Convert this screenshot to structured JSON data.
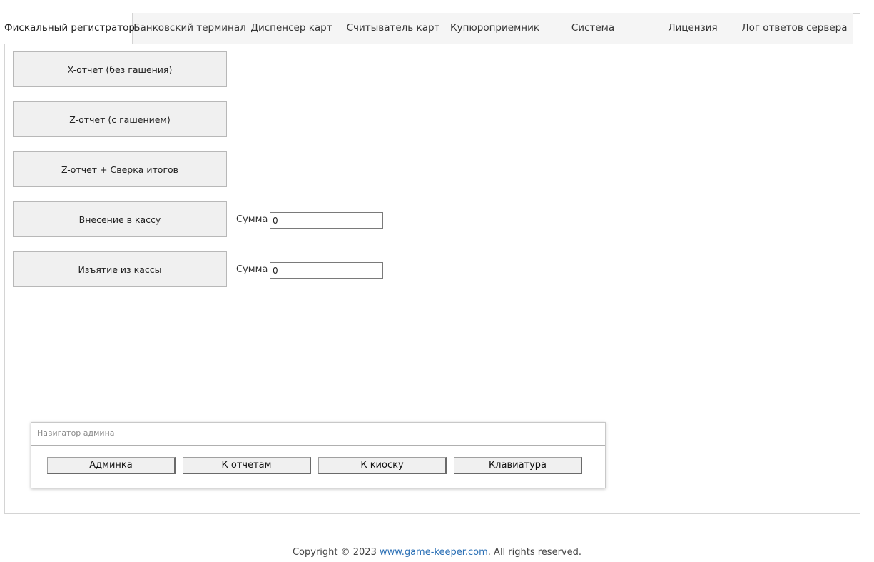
{
  "tabs": [
    {
      "label": "Фискальный регистратор",
      "active": true
    },
    {
      "label": "Банковский терминал",
      "active": false
    },
    {
      "label": "Диспенсер карт",
      "active": false
    },
    {
      "label": "Считыватель карт",
      "active": false
    },
    {
      "label": "Купюроприемник",
      "active": false
    },
    {
      "label": "Система",
      "active": false
    },
    {
      "label": "Лицензия",
      "active": false
    },
    {
      "label": "Лог ответов сервера",
      "active": false
    }
  ],
  "fiscal": {
    "x_report_label": "X-отчет (без гашения)",
    "z_report_label": "Z-отчет (с гашением)",
    "z_reconcile_label": "Z-отчет + Сверка итогов",
    "deposit_label": "Внесение в кассу",
    "deposit_sum_label": "Сумма",
    "deposit_sum_value": "0",
    "withdraw_label": "Изъятие из кассы",
    "withdraw_sum_label": "Сумма",
    "withdraw_sum_value": "0"
  },
  "admin_nav": {
    "title": "Навигатор админа",
    "buttons": [
      "Админка",
      "К отчетам",
      "К киоску",
      "Клавиатура"
    ]
  },
  "footer": {
    "prefix": "Copyright © 2023 ",
    "link_text": "www.game-keeper.com",
    "suffix": ". All rights reserved."
  }
}
